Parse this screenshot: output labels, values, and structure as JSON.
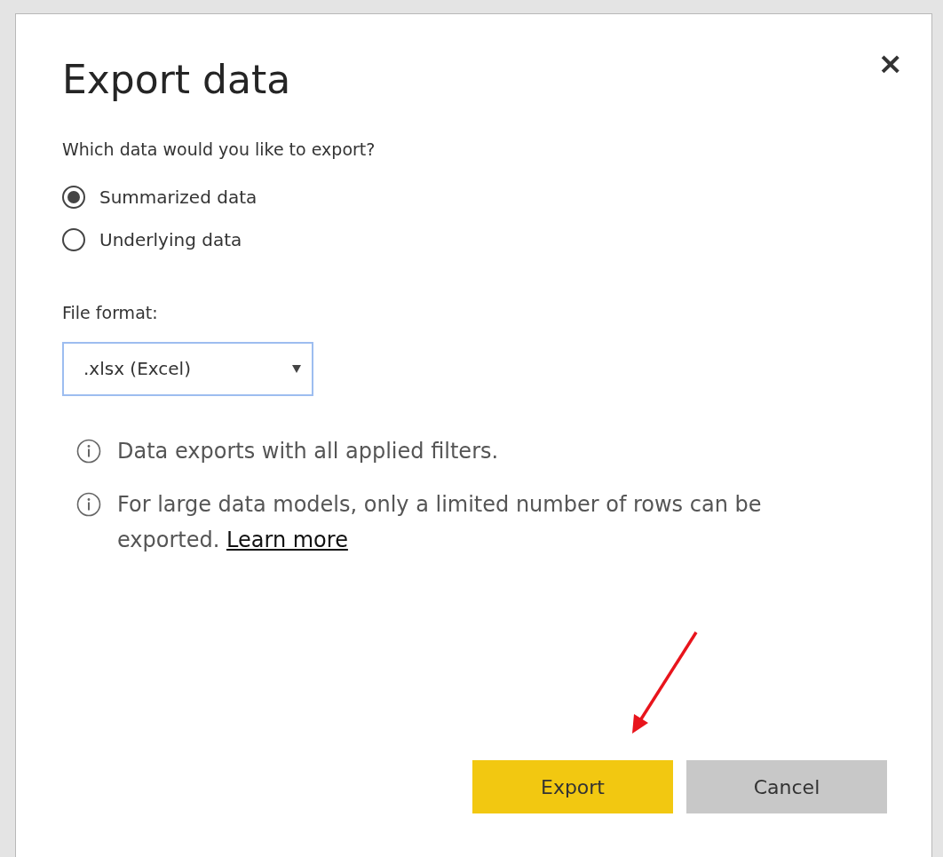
{
  "dialog": {
    "title": "Export data",
    "close": "×",
    "question": "Which data would you like to export?",
    "options": [
      {
        "label": "Summarized data",
        "selected": true
      },
      {
        "label": "Underlying data",
        "selected": false
      }
    ],
    "file_format": {
      "label": "File format:",
      "value": ".xlsx (Excel)"
    },
    "notes": [
      {
        "text": "Data exports with all applied filters."
      },
      {
        "text": "For large data models, only a limited number of rows can be exported.",
        "link": "Learn more"
      }
    ],
    "buttons": [
      {
        "label": "Export",
        "kind": "primary"
      },
      {
        "label": "Cancel",
        "kind": "secondary"
      }
    ]
  }
}
